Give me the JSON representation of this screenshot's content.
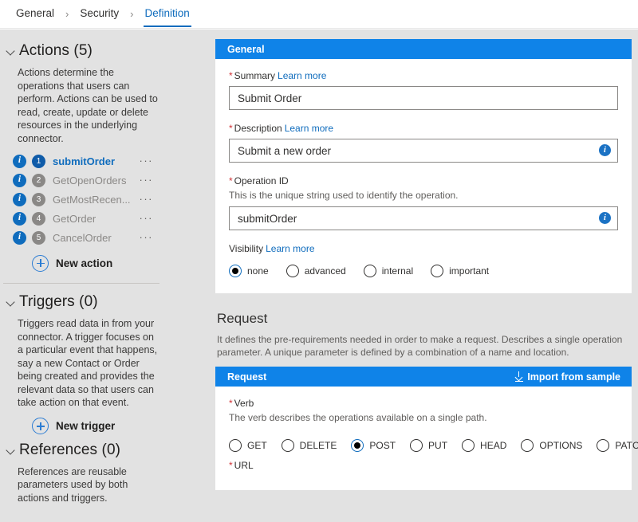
{
  "breadcrumb": {
    "items": [
      {
        "label": "General",
        "active": false
      },
      {
        "label": "Security",
        "active": false
      },
      {
        "label": "Definition",
        "active": true
      }
    ],
    "separator": "›"
  },
  "sidebar": {
    "actions": {
      "title": "Actions (5)",
      "description": "Actions determine the operations that users can perform. Actions can be used to read, create, update or delete resources in the underlying connector.",
      "items": [
        {
          "num": "1",
          "label": "submitOrder",
          "selected": true
        },
        {
          "num": "2",
          "label": "GetOpenOrders",
          "selected": false
        },
        {
          "num": "3",
          "label": "GetMostRecen...",
          "selected": false
        },
        {
          "num": "4",
          "label": "GetOrder",
          "selected": false
        },
        {
          "num": "5",
          "label": "CancelOrder",
          "selected": false
        }
      ],
      "new_label": "New action",
      "ellipsis": "···",
      "info_glyph": "i"
    },
    "triggers": {
      "title": "Triggers (0)",
      "description": "Triggers read data in from your connector. A trigger focuses on a particular event that happens, say a new Contact or Order being created and provides the relevant data so that users can take action on that event.",
      "new_label": "New trigger"
    },
    "references": {
      "title": "References (0)",
      "description": "References are reusable parameters used by both actions and triggers."
    }
  },
  "general": {
    "header": "General",
    "summary": {
      "label": "Summary",
      "required": "*",
      "learn_more": "Learn more",
      "value": "Submit Order"
    },
    "description": {
      "label": "Description",
      "required": "*",
      "learn_more": "Learn more",
      "value": "Submit a new order",
      "info_glyph": "i"
    },
    "operation_id": {
      "label": "Operation ID",
      "required": "*",
      "help": "This is the unique string used to identify the operation.",
      "value": "submitOrder",
      "info_glyph": "i"
    },
    "visibility": {
      "label": "Visibility",
      "learn_more": "Learn more",
      "options": [
        {
          "label": "none",
          "checked": true
        },
        {
          "label": "advanced",
          "checked": false
        },
        {
          "label": "internal",
          "checked": false
        },
        {
          "label": "important",
          "checked": false
        }
      ]
    }
  },
  "request": {
    "title": "Request",
    "description": "It defines the pre-requirements needed in order to make a request. Describes a single operation parameter. A unique parameter is defined by a combination of a name and location.",
    "header": "Request",
    "import_label": "Import from sample",
    "verb": {
      "label": "Verb",
      "required": "*",
      "help": "The verb describes the operations available on a single path.",
      "options": [
        {
          "label": "GET",
          "checked": false
        },
        {
          "label": "DELETE",
          "checked": false
        },
        {
          "label": "POST",
          "checked": true
        },
        {
          "label": "PUT",
          "checked": false
        },
        {
          "label": "HEAD",
          "checked": false
        },
        {
          "label": "OPTIONS",
          "checked": false
        },
        {
          "label": "PATCH",
          "checked": false
        }
      ]
    },
    "url": {
      "label": "URL",
      "required": "*"
    }
  },
  "colors": {
    "accent": "#0f83e8",
    "link": "#0f6cbd",
    "required": "#d13438",
    "page_bg": "#e2e2e2"
  }
}
